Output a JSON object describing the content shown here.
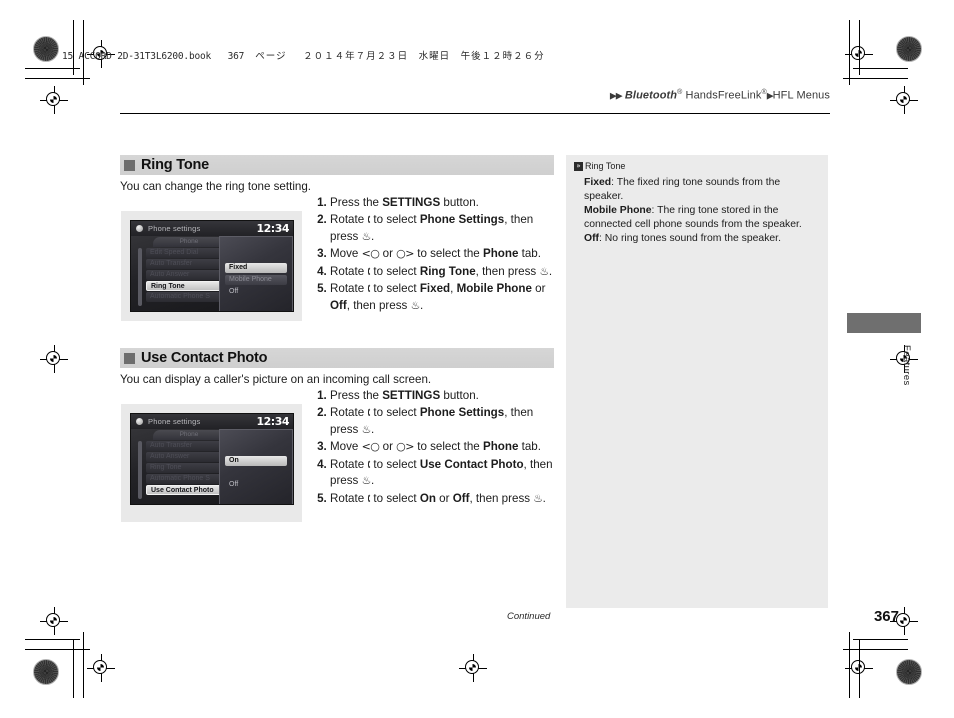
{
  "print": {
    "book_line": "15 ACCORD 2D-31T3L6200.book",
    "book_page": "367",
    "book_page_unit": "ページ",
    "book_date": "２０１４年７月２３日　水曜日　午後１２時２６分"
  },
  "header": {
    "breadcrumb_arrow": "▶▶",
    "breadcrumb_bluetooth": "Bluetooth",
    "breadcrumb_bt_sup": "®",
    "breadcrumb_hfl": " HandsFreeLink",
    "breadcrumb_hfl_sup": "®",
    "breadcrumb_arrow2": "▶",
    "breadcrumb_last": "HFL Menus"
  },
  "sections": [
    {
      "title": "Ring Tone",
      "intro": "You can change the ring tone setting.",
      "screen": {
        "title": "Phone settings",
        "clock": "12:34",
        "tab": "Phone",
        "items": [
          {
            "label": "Edit Speed Dial",
            "selected": false
          },
          {
            "label": "Auto Transfer",
            "selected": false
          },
          {
            "label": "Auto Answer",
            "selected": false
          },
          {
            "label": "Ring Tone",
            "selected": true
          },
          {
            "label": "Automatic Phone S",
            "selected": false
          }
        ],
        "popup": [
          {
            "label": "Fixed",
            "state": "sel"
          },
          {
            "label": "Mobile Phone",
            "state": "dim"
          },
          {
            "label": "Off",
            "state": "plain"
          }
        ]
      },
      "steps": [
        "Press the <b>SETTINGS</b> button.",
        "Rotate <span class=\"knob\">🕻</span> to select <b>Phone Settings</b>, then press <span class=\"knob\">♨</span>.",
        "Move <span class=\"knob\">&lt;○</span> or <span class=\"knob\">○&gt;</span> to select the <b>Phone</b> tab.",
        "Rotate <span class=\"knob\">🕻</span> to select <b>Ring Tone</b>, then press <span class=\"knob\">♨</span>.",
        "Rotate <span class=\"knob\">🕻</span> to select <b>Fixed</b>, <b>Mobile Phone</b> or <b>Off</b>, then press <span class=\"knob\">♨</span>."
      ]
    },
    {
      "title": "Use Contact Photo",
      "intro": "You can display a caller's picture on an incoming call screen.",
      "screen": {
        "title": "Phone settings",
        "clock": "12:34",
        "tab": "Phone",
        "items": [
          {
            "label": "Auto Transfer",
            "selected": false
          },
          {
            "label": "Auto Answer",
            "selected": false
          },
          {
            "label": "Ring Tone",
            "selected": false
          },
          {
            "label": "Automatic Phone S",
            "selected": false
          },
          {
            "label": "Use Contact Photo",
            "selected": true
          }
        ],
        "popup": [
          {
            "label": "On",
            "state": "sel"
          },
          {
            "label": "",
            "state": "blank"
          },
          {
            "label": "Off",
            "state": "plain"
          }
        ]
      },
      "steps": [
        "Press the <b>SETTINGS</b> button.",
        "Rotate <span class=\"knob\">🕻</span> to select <b>Phone Settings</b>, then press <span class=\"knob\">♨</span>.",
        "Move <span class=\"knob\">&lt;○</span> or <span class=\"knob\">○&gt;</span> to select the <b>Phone</b> tab.",
        "Rotate <span class=\"knob\">🕻</span> to select <b>Use Contact Photo</b>, then press <span class=\"knob\">♨</span>.",
        "Rotate <span class=\"knob\">🕻</span> to select <b>On</b> or <b>Off</b>, then press <span class=\"knob\">♨</span>."
      ]
    }
  ],
  "note": {
    "marker": "»",
    "title": "Ring Tone",
    "lines": [
      "<b>Fixed</b>: The fixed ring tone sounds from the speaker.",
      "<b>Mobile Phone</b>: The ring tone stored in the connected cell phone sounds from the speaker.",
      "<b>Off</b>: No ring tones sound from the speaker."
    ]
  },
  "thumb_index": {
    "label": "Features"
  },
  "footer": {
    "continued": "Continued",
    "page_number": "367"
  }
}
